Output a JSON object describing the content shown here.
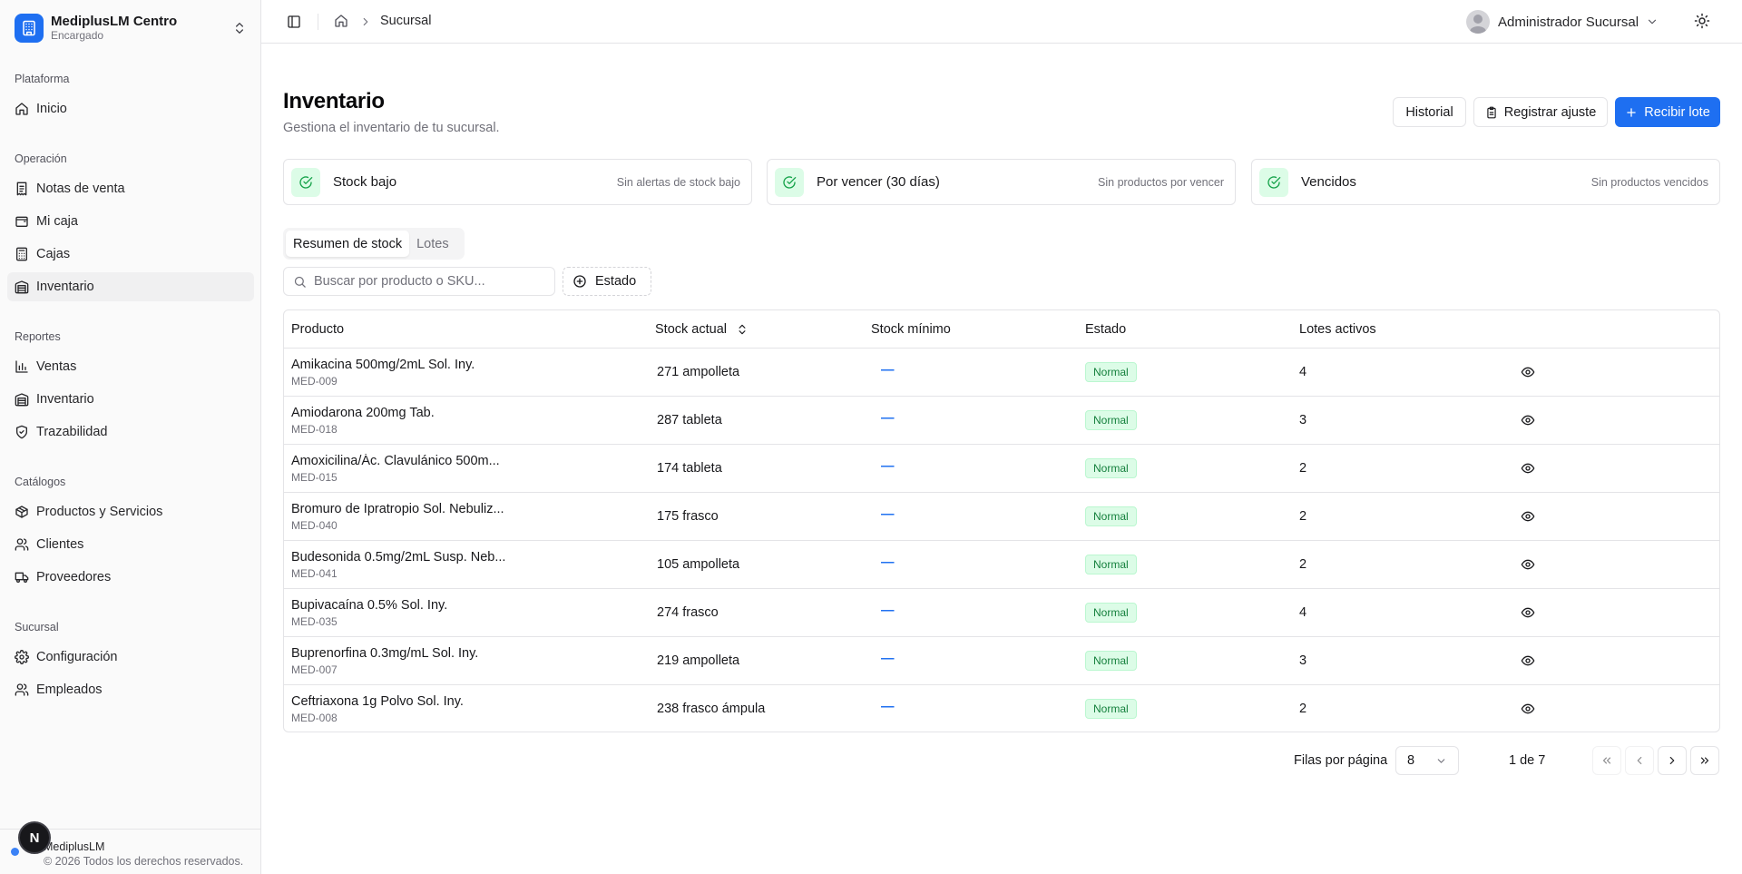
{
  "sidebar": {
    "brand": {
      "name": "MediplusLM Centro",
      "role": "Encargado"
    },
    "groups": [
      {
        "label": "Plataforma",
        "items": [
          {
            "label": "Inicio",
            "icon": "home-icon"
          }
        ]
      },
      {
        "label": "Operación",
        "items": [
          {
            "label": "Notas de venta",
            "icon": "receipt-icon"
          },
          {
            "label": "Mi caja",
            "icon": "wallet-icon"
          },
          {
            "label": "Cajas",
            "icon": "calculator-icon"
          },
          {
            "label": "Inventario",
            "icon": "warehouse-icon",
            "active": true
          }
        ]
      },
      {
        "label": "Reportes",
        "items": [
          {
            "label": "Ventas",
            "icon": "bar-chart-icon"
          },
          {
            "label": "Inventario",
            "icon": "warehouse-icon"
          },
          {
            "label": "Trazabilidad",
            "icon": "shield-icon"
          }
        ]
      },
      {
        "label": "Catálogos",
        "items": [
          {
            "label": "Productos y Servicios",
            "icon": "package-icon"
          },
          {
            "label": "Clientes",
            "icon": "users-icon"
          },
          {
            "label": "Proveedores",
            "icon": "truck-icon"
          }
        ]
      },
      {
        "label": "Sucursal",
        "items": [
          {
            "label": "Configuración",
            "icon": "gear-icon"
          },
          {
            "label": "Empleados",
            "icon": "users-icon"
          }
        ]
      }
    ],
    "footer": {
      "name": "MediplusLM",
      "copyright": "© 2026 Todos los derechos reservados.",
      "badge": "N"
    }
  },
  "header": {
    "breadcrumb": {
      "current": "Sucursal"
    },
    "user": {
      "name": "Administrador Sucursal"
    }
  },
  "page": {
    "title": "Inventario",
    "subtitle": "Gestiona el inventario de tu sucursal.",
    "actions": {
      "history": "Historial",
      "adjust": "Registrar ajuste",
      "receive": "Recibir lote"
    }
  },
  "stats": [
    {
      "title": "Stock bajo",
      "note": "Sin alertas de stock bajo"
    },
    {
      "title": "Por vencer (30 días)",
      "note": "Sin productos por vencer"
    },
    {
      "title": "Vencidos",
      "note": "Sin productos vencidos"
    }
  ],
  "tabs": [
    {
      "label": "Resumen de stock",
      "active": true
    },
    {
      "label": "Lotes",
      "active": false
    }
  ],
  "filters": {
    "search_placeholder": "Buscar por producto o SKU...",
    "status_label": "Estado"
  },
  "table": {
    "columns": [
      "Producto",
      "Stock actual",
      "Stock mínimo",
      "Estado",
      "Lotes activos"
    ],
    "rows": [
      {
        "name": "Amikacina 500mg/2mL Sol. Iny.",
        "sku": "MED-009",
        "stock": "271 ampolleta",
        "min": "—",
        "status": "Normal",
        "lots": "4"
      },
      {
        "name": "Amiodarona 200mg Tab.",
        "sku": "MED-018",
        "stock": "287 tableta",
        "min": "—",
        "status": "Normal",
        "lots": "3"
      },
      {
        "name": "Amoxicilina/Ác. Clavulánico 500m...",
        "sku": "MED-015",
        "stock": "174 tableta",
        "min": "—",
        "status": "Normal",
        "lots": "2"
      },
      {
        "name": "Bromuro de Ipratropio Sol. Nebuliz...",
        "sku": "MED-040",
        "stock": "175 frasco",
        "min": "—",
        "status": "Normal",
        "lots": "2"
      },
      {
        "name": "Budesonida 0.5mg/2mL Susp. Neb...",
        "sku": "MED-041",
        "stock": "105 ampolleta",
        "min": "—",
        "status": "Normal",
        "lots": "2"
      },
      {
        "name": "Bupivacaína 0.5% Sol. Iny.",
        "sku": "MED-035",
        "stock": "274 frasco",
        "min": "—",
        "status": "Normal",
        "lots": "4"
      },
      {
        "name": "Buprenorfina 0.3mg/mL Sol. Iny.",
        "sku": "MED-007",
        "stock": "219 ampolleta",
        "min": "—",
        "status": "Normal",
        "lots": "3"
      },
      {
        "name": "Ceftriaxona 1g Polvo Sol. Iny.",
        "sku": "MED-008",
        "stock": "238 frasco ámpula",
        "min": "—",
        "status": "Normal",
        "lots": "2"
      }
    ]
  },
  "pagination": {
    "rows_label": "Filas por página",
    "rows_value": "8",
    "page_info": "1 de 7"
  },
  "colors": {
    "accent": "#1e6ff1",
    "success_bg": "#dcfce7",
    "success_text": "#15803d"
  }
}
